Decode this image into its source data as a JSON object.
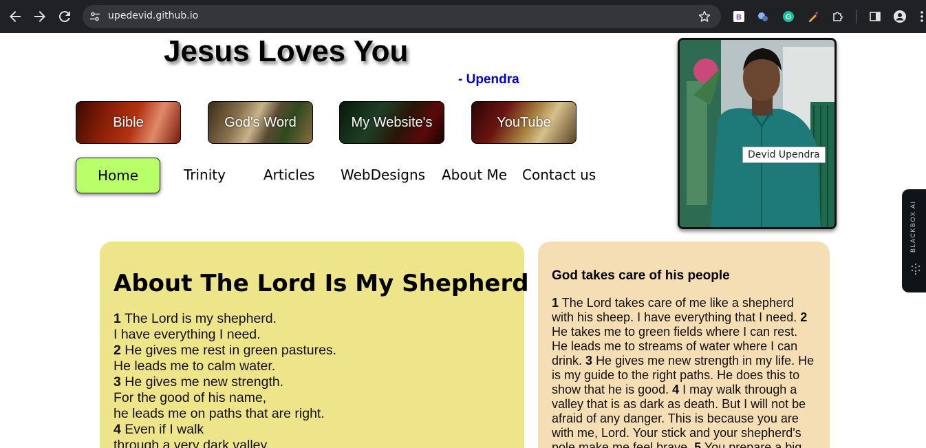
{
  "browser": {
    "url": "upedevid.github.io",
    "icons": [
      "back-icon",
      "forward-icon",
      "reload-icon",
      "site-settings-icon",
      "bookmark-star-icon"
    ],
    "extensions": [
      "bootstrap-extension-icon",
      "ai-extension-icon",
      "grammarly-extension-icon",
      "color-picker-extension-icon",
      "puzzle-extensions-icon",
      "side-panel-icon",
      "profile-icon",
      "more-menu-icon"
    ]
  },
  "header": {
    "title": "Jesus Loves You",
    "signature": "- Upendra"
  },
  "image_buttons": [
    "Bible",
    "God's Word",
    "My Website's",
    "YouTube"
  ],
  "nav": {
    "active": "Home",
    "links": [
      "Trinity",
      "Articles",
      "WebDesigns",
      "About Me",
      "Contact us"
    ]
  },
  "profile": {
    "tooltip": "Devid Upendra"
  },
  "side_widget": {
    "label": "BLACKBOX AI"
  },
  "main": {
    "heading_prefix": "About",
    "heading_bold": "The Lord Is My Shepherd",
    "verses": [
      {
        "num": "1",
        "text": "The Lord is my shepherd."
      },
      {
        "num": "",
        "text": "I have everything I need."
      },
      {
        "num": "2",
        "text": "He gives me rest in green pastures."
      },
      {
        "num": "",
        "text": "He leads me to calm water."
      },
      {
        "num": "3",
        "text": "He gives me new strength."
      },
      {
        "num": "",
        "text": "For the good of his name,"
      },
      {
        "num": "",
        "text": "he leads me on paths that are right."
      },
      {
        "num": "4",
        "text": "Even if I walk"
      },
      {
        "num": "",
        "text": "through a very dark valley,"
      }
    ]
  },
  "aside": {
    "heading": "God takes care of his people",
    "segments": [
      {
        "num": "1",
        "text": "The Lord takes care of me like a shepherd with his sheep. I have everything that I need."
      },
      {
        "num": "2",
        "text": "He takes me to green fields where I can rest. He leads me to streams of water where I can drink."
      },
      {
        "num": "3",
        "text": "He gives me new strength in my life. He is my guide to the right paths. He does this to show that he is good."
      },
      {
        "num": "4",
        "text": "I may walk through a valley that is as dark as death. But I will not be afraid of any danger. This is because you are with me, Lord. Your stick and your shepherd's pole make me feel brave."
      },
      {
        "num": "5",
        "text": "You prepare a big meal for me"
      }
    ]
  }
}
